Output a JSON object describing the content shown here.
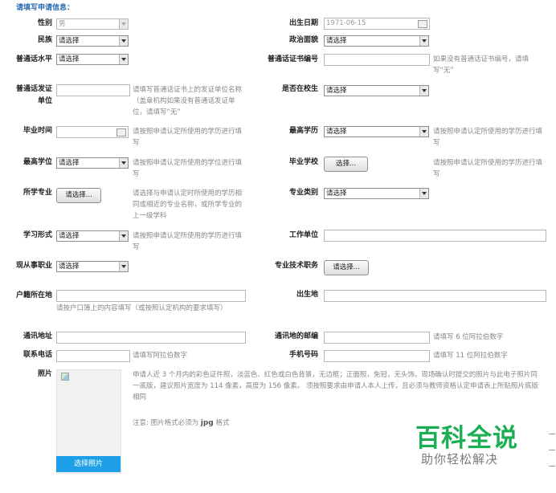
{
  "form_title": "请填写申请信息：",
  "fields": {
    "gender": {
      "label": "性别",
      "value": "男"
    },
    "birth_date": {
      "label": "出生日期",
      "value": "1971-06-15"
    },
    "ethnicity": {
      "label": "民族",
      "value": "请选择"
    },
    "political_status": {
      "label": "政治面貌",
      "value": "请选择"
    },
    "mandarin_level": {
      "label": "普通话水平",
      "value": "请选择"
    },
    "mandarin_cert_no": {
      "label": "普通话证书编号",
      "value": "",
      "hint": "如果没有普通话证书编号，请填写“无”"
    },
    "mandarin_issuer": {
      "label": "普通话发证单位",
      "value": "",
      "hint": "请填写普通话证书上的发证单位名称（盖章机构如果没有普通话发证单位，请填写“无”"
    },
    "in_school": {
      "label": "是否在校生",
      "value": "请选择"
    },
    "grad_time": {
      "label": "毕业时间",
      "value": "",
      "hint": "请按照申请认定所使用的学历进行填写"
    },
    "highest_edu": {
      "label": "最高学历",
      "value": "请选择",
      "hint": "请按照申请认定所使用的学历进行填写"
    },
    "highest_degree": {
      "label": "最高学位",
      "value": "请选择",
      "hint": "请按照申请认定所使用的学位进行填写"
    },
    "grad_school": {
      "label": "毕业学校",
      "button": "选择...",
      "hint": "请按照申请认定所使用的学历进行填写"
    },
    "major": {
      "label": "所学专业",
      "button": "请选择...",
      "hint": "请选择与申请认定时所使用的学历相同或相近的专业名称，或所学专业的上一级学科"
    },
    "major_category": {
      "label": "专业类别",
      "value": "请选择"
    },
    "study_form": {
      "label": "学习形式",
      "value": "请选择",
      "hint": "请按照申请认定所使用的学历进行填写"
    },
    "employer": {
      "label": "工作单位",
      "value": ""
    },
    "current_job": {
      "label": "现从事职业",
      "value": "请选择"
    },
    "tech_title": {
      "label": "专业技术职务",
      "button": "请选择..."
    },
    "household": {
      "label": "户籍所在地",
      "value": "",
      "hint": "请按户口簿上的内容填写（或按照认定机构的要求填写）"
    },
    "birthplace": {
      "label": "出生地",
      "value": ""
    },
    "address": {
      "label": "通讯地址",
      "value": ""
    },
    "postcode": {
      "label": "通讯地的邮编",
      "value": "",
      "hint": "请填写 6 位阿拉伯数字"
    },
    "phone": {
      "label": "联系电话",
      "value": "",
      "hint": "请填写阿拉伯数字"
    },
    "mobile": {
      "label": "手机号码",
      "value": "",
      "hint": "请填写 11 位阿拉伯数字"
    },
    "photo": {
      "label": "照片",
      "button": "选择照片",
      "hint": "申请人近 3 个月内的彩色证件照，淡蓝色、红色或白色背景，无边框；正面照，免冠，无头饰。现场确认时提交的照片与此电子照片同一底版，建议照片宽度为 114 像素，高度为 156 像素。 须按照要求由申请人本人上传，且必须与教师资格认定申请表上所贴照片底版相同",
      "note_prefix": "注意: 图片格式必须为 ",
      "note_format": "jpg",
      "note_suffix": " 格式"
    }
  },
  "watermark": {
    "brand": "百科全说",
    "slogan": "助你轻松解决"
  }
}
